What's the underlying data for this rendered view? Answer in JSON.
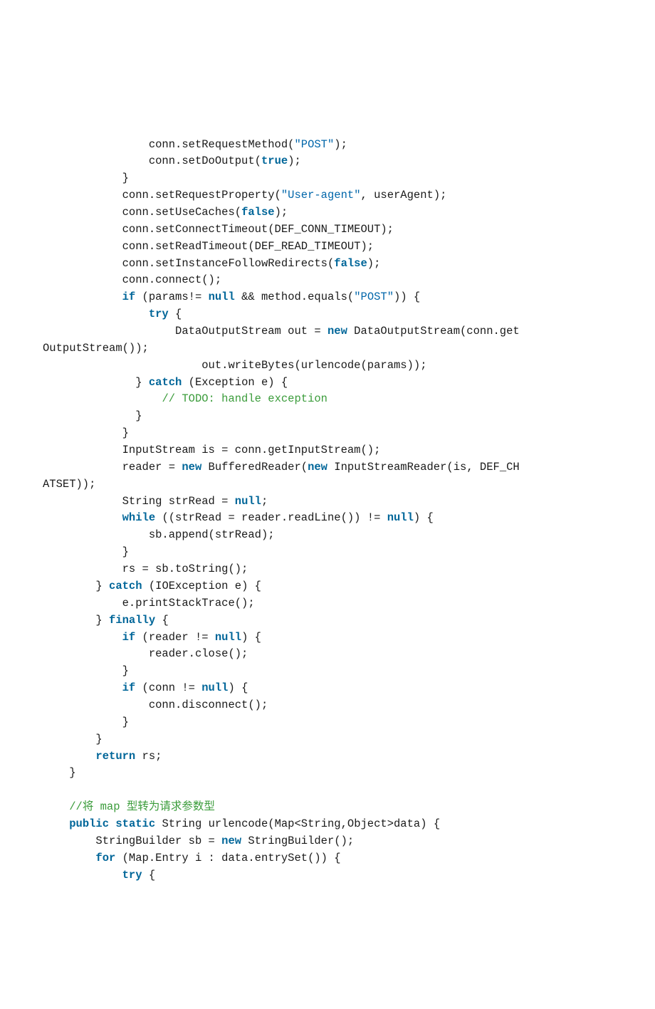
{
  "code": {
    "lines": [
      {
        "indent": 16,
        "tokens": [
          {
            "t": "conn.setRequestMethod("
          },
          {
            "t": "\"POST\"",
            "c": "str"
          },
          {
            "t": ");"
          }
        ]
      },
      {
        "indent": 16,
        "tokens": [
          {
            "t": "conn.setDoOutput("
          },
          {
            "t": "true",
            "c": "kw"
          },
          {
            "t": ");"
          }
        ]
      },
      {
        "indent": 12,
        "tokens": [
          {
            "t": "}"
          }
        ]
      },
      {
        "indent": 12,
        "tokens": [
          {
            "t": "conn.setRequestProperty("
          },
          {
            "t": "\"User-agent\"",
            "c": "str"
          },
          {
            "t": ", userAgent);"
          }
        ]
      },
      {
        "indent": 12,
        "tokens": [
          {
            "t": "conn.setUseCaches("
          },
          {
            "t": "false",
            "c": "kw"
          },
          {
            "t": ");"
          }
        ]
      },
      {
        "indent": 12,
        "tokens": [
          {
            "t": "conn.setConnectTimeout(DEF_CONN_TIMEOUT);"
          }
        ]
      },
      {
        "indent": 12,
        "tokens": [
          {
            "t": "conn.setReadTimeout(DEF_READ_TIMEOUT);"
          }
        ]
      },
      {
        "indent": 12,
        "tokens": [
          {
            "t": "conn.setInstanceFollowRedirects("
          },
          {
            "t": "false",
            "c": "kw"
          },
          {
            "t": ");"
          }
        ]
      },
      {
        "indent": 12,
        "tokens": [
          {
            "t": "conn.connect();"
          }
        ]
      },
      {
        "indent": 12,
        "tokens": [
          {
            "t": "if",
            "c": "kw"
          },
          {
            "t": " (params!= "
          },
          {
            "t": "null",
            "c": "kw"
          },
          {
            "t": " && method.equals("
          },
          {
            "t": "\"POST\"",
            "c": "str"
          },
          {
            "t": ")) {"
          }
        ]
      },
      {
        "indent": 16,
        "tokens": [
          {
            "t": "try",
            "c": "kw"
          },
          {
            "t": " {"
          }
        ]
      },
      {
        "indent": 20,
        "tokens": [
          {
            "t": "DataOutputStream out = "
          },
          {
            "t": "new",
            "c": "kw"
          },
          {
            "t": " DataOutputStream(conn.get"
          }
        ]
      },
      {
        "indent": -1,
        "tokens": [
          {
            "t": "OutputStream());"
          }
        ]
      },
      {
        "indent": 24,
        "tokens": [
          {
            "t": "out.writeBytes(urlencode(params));"
          }
        ]
      },
      {
        "indent": 14,
        "tokens": [
          {
            "t": "} "
          },
          {
            "t": "catch",
            "c": "kw"
          },
          {
            "t": " (Exception e) {"
          }
        ]
      },
      {
        "indent": 18,
        "tokens": [
          {
            "t": "// TODO: handle exception",
            "c": "cmt"
          }
        ]
      },
      {
        "indent": 14,
        "tokens": [
          {
            "t": "}"
          }
        ]
      },
      {
        "indent": 12,
        "tokens": [
          {
            "t": "}"
          }
        ]
      },
      {
        "indent": 12,
        "tokens": [
          {
            "t": "InputStream is = conn.getInputStream();"
          }
        ]
      },
      {
        "indent": 12,
        "tokens": [
          {
            "t": "reader = "
          },
          {
            "t": "new",
            "c": "kw"
          },
          {
            "t": " BufferedReader("
          },
          {
            "t": "new",
            "c": "kw"
          },
          {
            "t": " InputStreamReader(is, DEF_CH"
          }
        ]
      },
      {
        "indent": -1,
        "tokens": [
          {
            "t": "ATSET));"
          }
        ]
      },
      {
        "indent": 12,
        "tokens": [
          {
            "t": "String strRead = "
          },
          {
            "t": "null",
            "c": "kw"
          },
          {
            "t": ";"
          }
        ]
      },
      {
        "indent": 12,
        "tokens": [
          {
            "t": "while",
            "c": "kw"
          },
          {
            "t": " ((strRead = reader.readLine()) != "
          },
          {
            "t": "null",
            "c": "kw"
          },
          {
            "t": ") {"
          }
        ]
      },
      {
        "indent": 16,
        "tokens": [
          {
            "t": "sb.append(strRead);"
          }
        ]
      },
      {
        "indent": 12,
        "tokens": [
          {
            "t": "}"
          }
        ]
      },
      {
        "indent": 12,
        "tokens": [
          {
            "t": "rs = sb.toString();"
          }
        ]
      },
      {
        "indent": 8,
        "tokens": [
          {
            "t": "} "
          },
          {
            "t": "catch",
            "c": "kw"
          },
          {
            "t": " (IOException e) {"
          }
        ]
      },
      {
        "indent": 12,
        "tokens": [
          {
            "t": "e.printStackTrace();"
          }
        ]
      },
      {
        "indent": 8,
        "tokens": [
          {
            "t": "} "
          },
          {
            "t": "finally",
            "c": "kw"
          },
          {
            "t": " {"
          }
        ]
      },
      {
        "indent": 12,
        "tokens": [
          {
            "t": "if",
            "c": "kw"
          },
          {
            "t": " (reader != "
          },
          {
            "t": "null",
            "c": "kw"
          },
          {
            "t": ") {"
          }
        ]
      },
      {
        "indent": 16,
        "tokens": [
          {
            "t": "reader.close();"
          }
        ]
      },
      {
        "indent": 12,
        "tokens": [
          {
            "t": "}"
          }
        ]
      },
      {
        "indent": 12,
        "tokens": [
          {
            "t": "if",
            "c": "kw"
          },
          {
            "t": " (conn != "
          },
          {
            "t": "null",
            "c": "kw"
          },
          {
            "t": ") {"
          }
        ]
      },
      {
        "indent": 16,
        "tokens": [
          {
            "t": "conn.disconnect();"
          }
        ]
      },
      {
        "indent": 12,
        "tokens": [
          {
            "t": "}"
          }
        ]
      },
      {
        "indent": 8,
        "tokens": [
          {
            "t": "}"
          }
        ]
      },
      {
        "indent": 8,
        "tokens": [
          {
            "t": "return",
            "c": "kw"
          },
          {
            "t": " rs;"
          }
        ]
      },
      {
        "indent": 4,
        "tokens": [
          {
            "t": "}"
          }
        ]
      },
      {
        "indent": 0,
        "tokens": [
          {
            "t": ""
          }
        ]
      },
      {
        "indent": 4,
        "tokens": [
          {
            "t": "//将 map 型转为请求参数型",
            "c": "cmt"
          }
        ]
      },
      {
        "indent": 4,
        "tokens": [
          {
            "t": "public",
            "c": "kw"
          },
          {
            "t": " "
          },
          {
            "t": "static",
            "c": "kw"
          },
          {
            "t": " String urlencode(Map<String,Object>data) {"
          }
        ]
      },
      {
        "indent": 8,
        "tokens": [
          {
            "t": "StringBuilder sb = "
          },
          {
            "t": "new",
            "c": "kw"
          },
          {
            "t": " StringBuilder();"
          }
        ]
      },
      {
        "indent": 8,
        "tokens": [
          {
            "t": "for",
            "c": "kw"
          },
          {
            "t": " (Map.Entry i : data.entrySet()) {"
          }
        ]
      },
      {
        "indent": 12,
        "tokens": [
          {
            "t": "try",
            "c": "kw"
          },
          {
            "t": " {"
          }
        ]
      }
    ]
  }
}
